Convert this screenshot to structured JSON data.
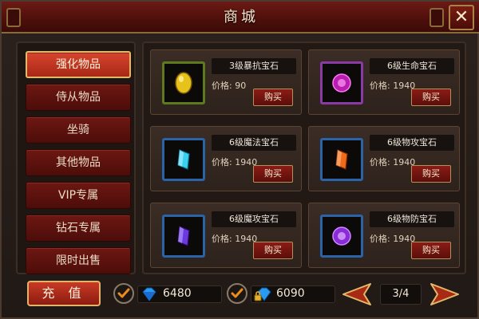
{
  "window": {
    "title": "商城",
    "close_label": "✕"
  },
  "sidebar": {
    "items": [
      {
        "label": "强化物品",
        "active": true
      },
      {
        "label": "侍从物品",
        "active": false
      },
      {
        "label": "坐骑",
        "active": false
      },
      {
        "label": "其他物品",
        "active": false
      },
      {
        "label": "VIP专属",
        "active": false
      },
      {
        "label": "钻石专属",
        "active": false
      },
      {
        "label": "限时出售",
        "active": false
      }
    ]
  },
  "items": [
    {
      "name": "3级暴抗宝石",
      "price": "价格: 90",
      "buy": "购买",
      "icon": "yellow-gem-icon",
      "color": "#e6c21a"
    },
    {
      "name": "6级生命宝石",
      "price": "价格: 1940",
      "buy": "购买",
      "icon": "pink-gem-icon",
      "color": "#e23ad6"
    },
    {
      "name": "6级魔法宝石",
      "price": "价格: 1940",
      "buy": "购买",
      "icon": "blue-crystal-icon",
      "color": "#3ad0f0"
    },
    {
      "name": "6级物攻宝石",
      "price": "价格: 1940",
      "buy": "购买",
      "icon": "orange-crystal-icon",
      "color": "#f06a1a"
    },
    {
      "name": "6级魔攻宝石",
      "price": "价格: 1940",
      "buy": "购买",
      "icon": "indigo-crystal-icon",
      "color": "#6a3ae0"
    },
    {
      "name": "6级物防宝石",
      "price": "价格: 1940",
      "buy": "购买",
      "icon": "violet-gem-icon",
      "color": "#a23af0"
    }
  ],
  "footer": {
    "recharge_label": "充 值",
    "diamonds": "6480",
    "bound_diamonds": "6090",
    "page": "3/4"
  }
}
